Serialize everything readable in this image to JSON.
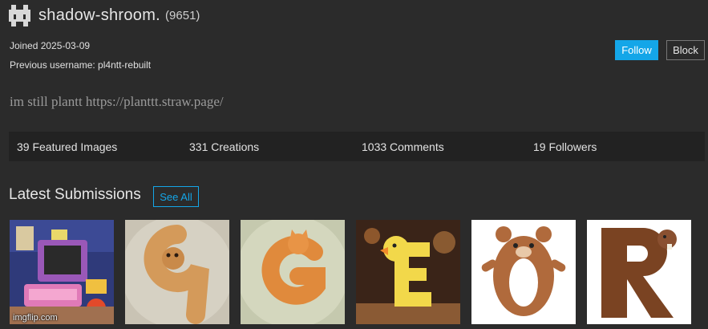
{
  "profile": {
    "username": "shadow-shroom.",
    "points": "(9651)",
    "joined": "Joined 2025-03-09",
    "previous_username": "Previous username: pl4ntt-rebuilt",
    "bio": "im still plantt https://planttt.straw.page/"
  },
  "actions": {
    "follow_label": "Follow",
    "block_label": "Block"
  },
  "stats": {
    "featured": "39 Featured Images",
    "creations": "331 Creations",
    "comments": "1033 Comments",
    "followers": "19 Followers"
  },
  "submissions": {
    "heading": "Latest Submissions",
    "see_all_label": "See All",
    "thumbnails": [
      "retro-computer-toy",
      "dog-shaped-9",
      "cat-shaped-g",
      "duck-shaped-e",
      "bear-shaped-o",
      "beaver-shaped-r"
    ]
  },
  "watermark": "imgflip.com",
  "colors": {
    "accent": "#14a6e8",
    "background": "#2b2b2b",
    "stats_bar": "#222222"
  }
}
